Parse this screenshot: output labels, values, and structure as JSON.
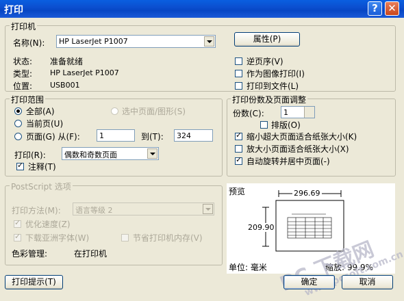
{
  "window": {
    "title": "打印",
    "help_glyph": "?",
    "close_glyph": "✕"
  },
  "printer": {
    "legend": "打印机",
    "name_label": "名称(N):",
    "name_value": "HP LaserJet P1007",
    "properties_button": "属性(P)",
    "status_label": "状态:",
    "status_value": "准备就绪",
    "type_label": "类型:",
    "type_value": "HP LaserJet P1007",
    "location_label": "位置:",
    "location_value": "USB001",
    "reverse_order": {
      "label": "逆页序(V)",
      "checked": false
    },
    "print_as_image": {
      "label": "作为图像打印(I)",
      "checked": false
    },
    "print_to_file": {
      "label": "打印到文件(L)",
      "checked": false
    }
  },
  "range": {
    "legend": "打印范围",
    "all": "全部(A)",
    "selection": "选中页面/图形(S)",
    "current": "当前页(U)",
    "pages": "页面(G) 从(F):",
    "from": "1",
    "to_label": "到(T):",
    "to": "324",
    "print_label": "打印(R):",
    "print_value": "偶数和奇数页面",
    "comments": {
      "label": "注释(T)",
      "checked": true
    }
  },
  "copies": {
    "legend": "打印份数及页面调整",
    "copies_label": "份数(C):",
    "copies_value": "1",
    "collate": {
      "label": "排版(O)",
      "checked": false
    },
    "shrink": {
      "label": "缩小超大页面适合纸张大小(K)",
      "checked": true
    },
    "expand": {
      "label": "放大小页面适合纸张大小(X)",
      "checked": false
    },
    "autorotate": {
      "label": "自动旋转并居中页面(-)",
      "checked": true
    }
  },
  "postscript": {
    "legend": "PostScript 选项",
    "method_label": "打印方法(M):",
    "method_value": "语言等级 2",
    "optimize": {
      "label": "优化速度(Z)",
      "checked": true
    },
    "download_fonts": {
      "label": "下载亚洲字体(W)",
      "checked": true
    },
    "save_memory": {
      "label": "节省打印机内存(V)",
      "checked": false
    },
    "color_label": "色彩管理:",
    "color_value": "在打印机"
  },
  "preview": {
    "label": "预览",
    "width": "296.69",
    "height": "209.90",
    "unit": "单位: 毫米",
    "zoom": "缩放: 99.9%"
  },
  "footer": {
    "tips_button": "打印提示(T)",
    "ok_button": "确定",
    "cancel_button": "取消"
  },
  "watermark": {
    "brand": "PC 下载网",
    "url": "www.pcsoft.com.cn"
  }
}
